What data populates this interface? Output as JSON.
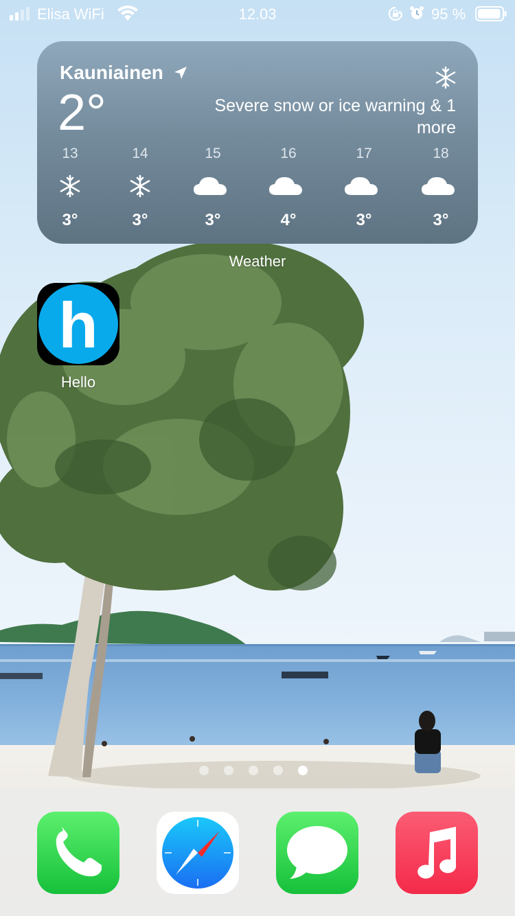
{
  "status_bar": {
    "carrier": "Elisa WiFi",
    "time": "12.03",
    "battery_percent": "95 %",
    "battery_level": 0.95,
    "icons": [
      "signal-icon",
      "wifi-icon",
      "orientation-lock-icon",
      "alarm-icon",
      "battery-icon"
    ]
  },
  "weather_widget": {
    "city": "Kauniainen",
    "temperature": "2°",
    "condition_icon": "snowflake-icon",
    "alert": "Severe snow or ice warning & 1 more",
    "forecast": [
      {
        "day": "13",
        "icon": "snowflake",
        "temp": "3°"
      },
      {
        "day": "14",
        "icon": "snowflake",
        "temp": "3°"
      },
      {
        "day": "15",
        "icon": "cloud",
        "temp": "3°"
      },
      {
        "day": "16",
        "icon": "cloud",
        "temp": "4°"
      },
      {
        "day": "17",
        "icon": "cloud",
        "temp": "3°"
      },
      {
        "day": "18",
        "icon": "cloud",
        "temp": "3°"
      }
    ],
    "label": "Weather"
  },
  "apps": [
    {
      "label": "Hello",
      "icon_letter": "h",
      "icon_color": "#08aaeb"
    }
  ],
  "page_dots": {
    "count": 5,
    "active_index": 4
  },
  "dock": [
    {
      "name": "Phone",
      "icon": "phone-icon"
    },
    {
      "name": "Safari",
      "icon": "compass-icon"
    },
    {
      "name": "Messages",
      "icon": "speech-bubble-icon"
    },
    {
      "name": "Music",
      "icon": "music-note-icon"
    }
  ]
}
